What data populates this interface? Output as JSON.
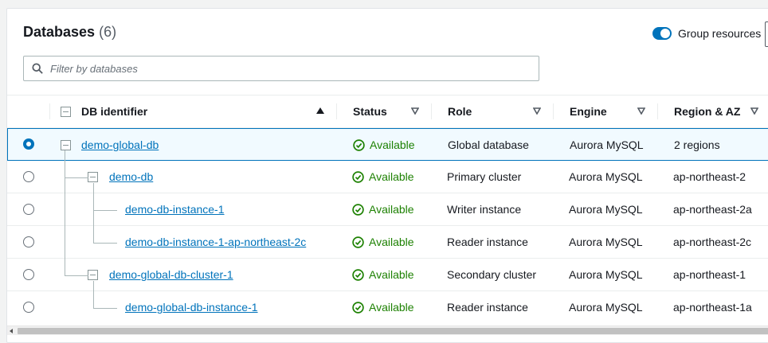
{
  "header": {
    "title": "Databases",
    "count": "(6)"
  },
  "toggle": {
    "label": "Group resources",
    "on": true
  },
  "search": {
    "placeholder": "Filter by databases",
    "value": ""
  },
  "columns": [
    {
      "label": "DB identifier",
      "sort": "ascending"
    },
    {
      "label": "Status"
    },
    {
      "label": "Role"
    },
    {
      "label": "Engine"
    },
    {
      "label": "Region & AZ"
    }
  ],
  "rows": [
    {
      "id": "demo-global-db",
      "status": "Available",
      "role": "Global database",
      "engine": "Aurora MySQL",
      "region": "2 regions",
      "selected": true
    },
    {
      "id": "demo-db",
      "status": "Available",
      "role": "Primary cluster",
      "engine": "Aurora MySQL",
      "region": "ap-northeast-2",
      "selected": false
    },
    {
      "id": "demo-db-instance-1",
      "status": "Available",
      "role": "Writer instance",
      "engine": "Aurora MySQL",
      "region": "ap-northeast-2a",
      "selected": false
    },
    {
      "id": "demo-db-instance-1-ap-northeast-2c",
      "status": "Available",
      "role": "Reader instance",
      "engine": "Aurora MySQL",
      "region": "ap-northeast-2c",
      "selected": false
    },
    {
      "id": "demo-global-db-cluster-1",
      "status": "Available",
      "role": "Secondary cluster",
      "engine": "Aurora MySQL",
      "region": "ap-northeast-1",
      "selected": false
    },
    {
      "id": "demo-global-db-instance-1",
      "status": "Available",
      "role": "Reader instance",
      "engine": "Aurora MySQL",
      "region": "ap-northeast-1a",
      "selected": false
    }
  ],
  "colors": {
    "accent": "#0073bb",
    "success": "#1d8102",
    "border": "#eaeded"
  }
}
